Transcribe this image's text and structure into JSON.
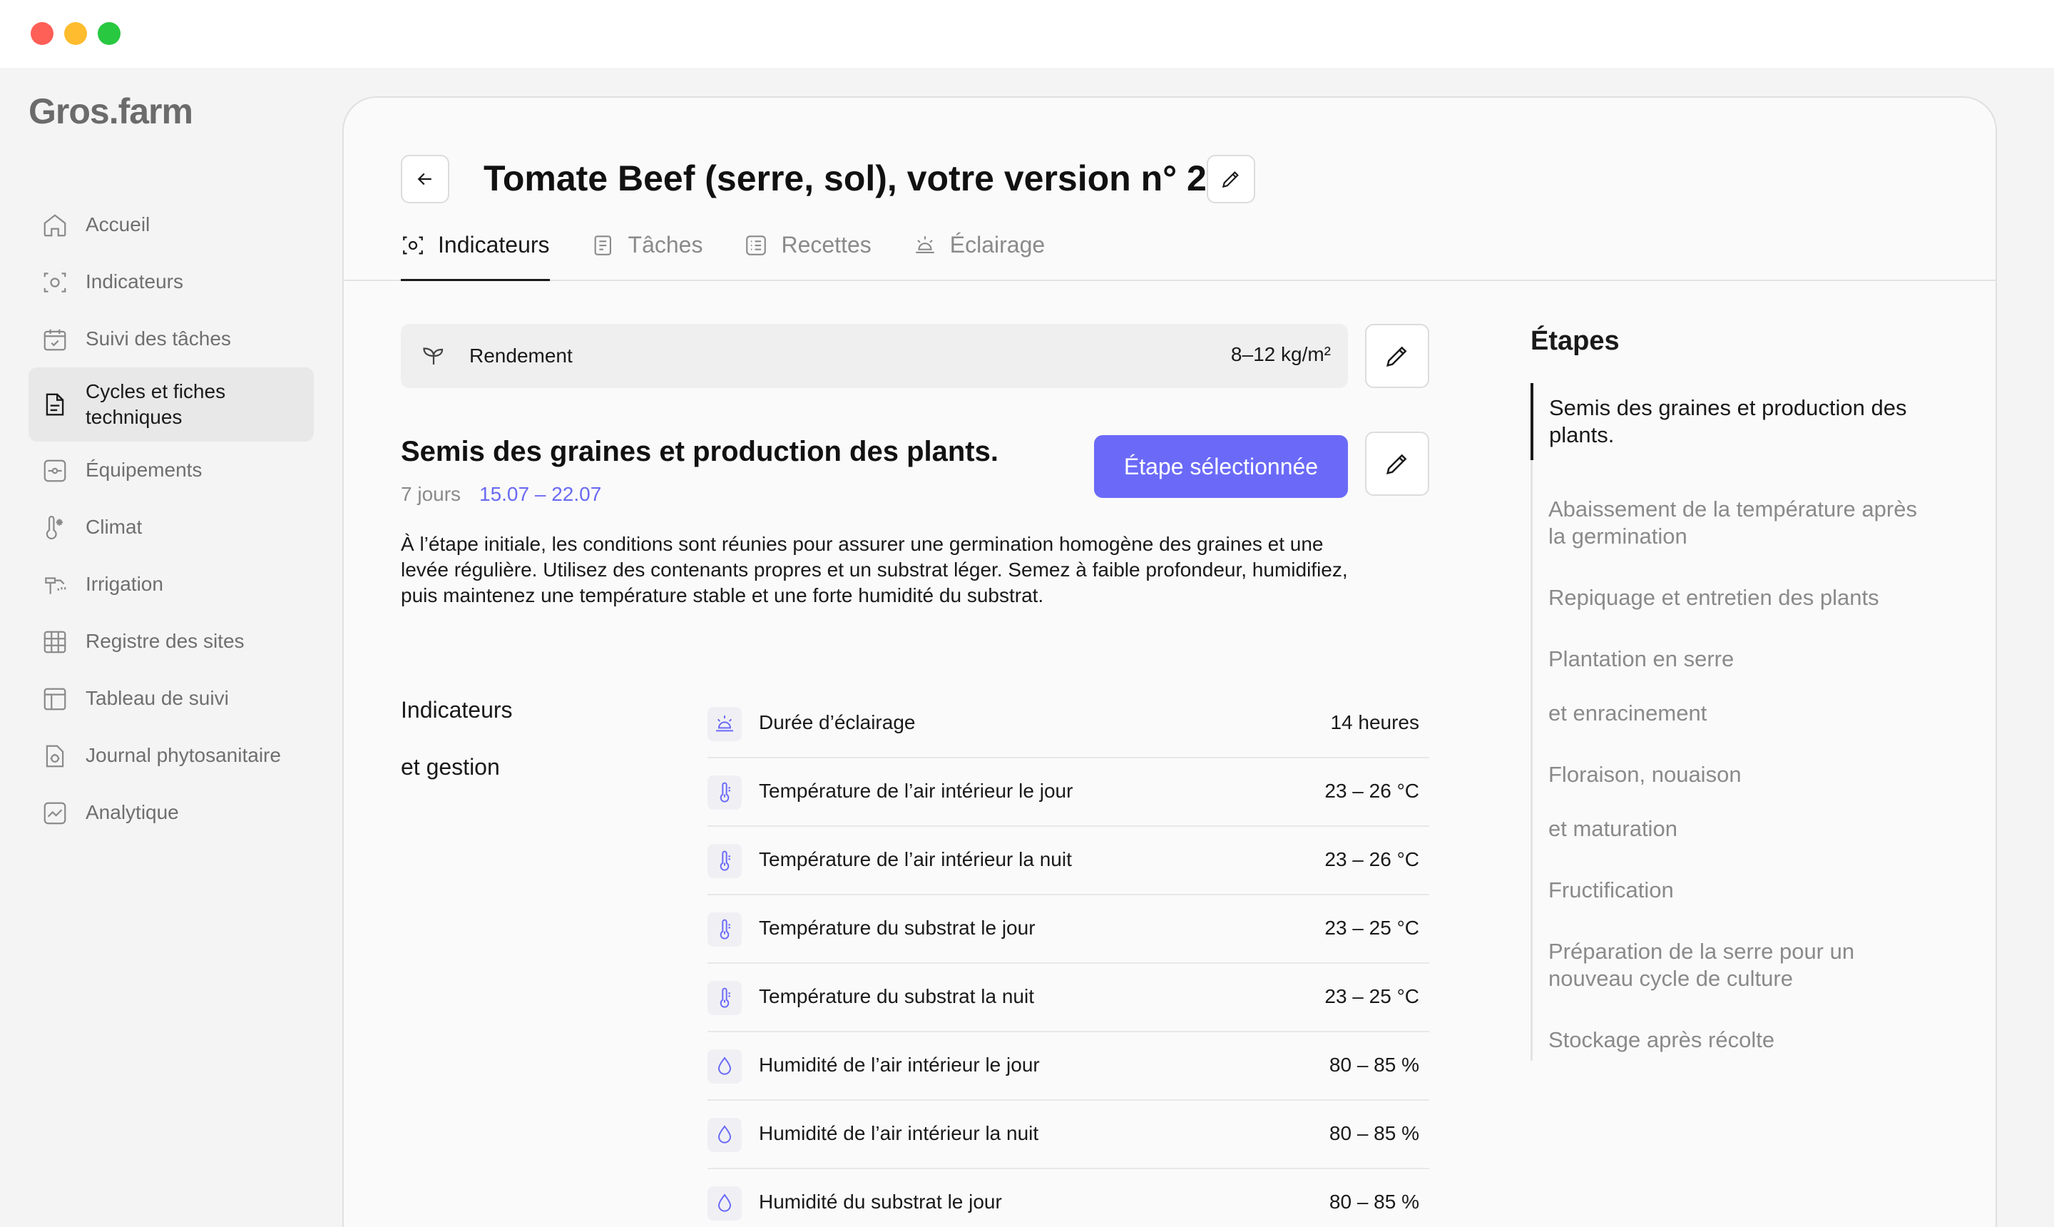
{
  "app": {
    "logo": "Gros.farm"
  },
  "sidebar": {
    "items": [
      {
        "label": "Accueil",
        "icon": "home-icon"
      },
      {
        "label": "Indicateurs",
        "icon": "indicators-icon"
      },
      {
        "label": "Suivi des tâches",
        "icon": "calendar-check-icon"
      },
      {
        "label": "Cycles et fiches techniques",
        "icon": "document-icon",
        "active": true
      },
      {
        "label": "Équipements",
        "icon": "equipment-icon"
      },
      {
        "label": "Climat",
        "icon": "climate-icon"
      },
      {
        "label": "Irrigation",
        "icon": "irrigation-icon"
      },
      {
        "label": "Registre des sites",
        "icon": "grid-icon"
      },
      {
        "label": "Tableau de suivi",
        "icon": "table-icon"
      },
      {
        "label": "Journal phytosanitaire",
        "icon": "journal-icon"
      },
      {
        "label": "Analytique",
        "icon": "analytics-icon"
      }
    ]
  },
  "header": {
    "title": "Tomate Beef (serre, sol), votre version n° 2",
    "tabs": [
      {
        "label": "Indicateurs",
        "icon": "indicators-icon",
        "active": true
      },
      {
        "label": "Tâches",
        "icon": "tasks-icon"
      },
      {
        "label": "Recettes",
        "icon": "recipes-icon"
      },
      {
        "label": "Éclairage",
        "icon": "light-icon"
      }
    ]
  },
  "yield": {
    "label": "Rendement",
    "value": "8–12 kg/m²",
    "icon": "sprout-icon"
  },
  "stage": {
    "title": "Semis des graines et production des plants.",
    "days": "7 jours",
    "dates": "15.07 – 22.07",
    "selected_label": "Étape sélectionnée",
    "description": "À l’étape initiale, les conditions sont réunies pour assurer une germination homogène des graines et une levée régulière. Utilisez des contenants propres et un substrat léger. Semez à faible profondeur, humidifiez, puis maintenez une température stable et une forte humidité du substrat."
  },
  "indicators": {
    "title_line1": "Indicateurs",
    "title_line2": "et gestion",
    "rows": [
      {
        "label": "Durée d’éclairage",
        "value": "14 heures",
        "icon": "light-icon"
      },
      {
        "label": "Température de l’air intérieur le jour",
        "value": "23 – 26 °C",
        "icon": "thermometer-icon"
      },
      {
        "label": "Température de l’air intérieur la nuit",
        "value": "23 – 26 °C",
        "icon": "thermometer-icon"
      },
      {
        "label": "Température du substrat le jour",
        "value": "23 – 25 °C",
        "icon": "thermometer-icon"
      },
      {
        "label": "Température du substrat la nuit",
        "value": "23 – 25 °C",
        "icon": "thermometer-icon"
      },
      {
        "label": "Humidité de l’air intérieur le jour",
        "value": "80 – 85 %",
        "icon": "droplet-icon"
      },
      {
        "label": "Humidité de l’air intérieur la nuit",
        "value": "80 – 85 %",
        "icon": "droplet-icon"
      },
      {
        "label": "Humidité du substrat le jour",
        "value": "80 – 85 %",
        "icon": "droplet-icon"
      }
    ]
  },
  "steps": {
    "title": "Étapes",
    "items": [
      {
        "label": "Semis des graines et production des plants.",
        "active": true
      },
      {
        "label": "Abaissement de la température après la germination"
      },
      {
        "label": "Repiquage et entretien des plants"
      },
      {
        "label": "Plantation en serre"
      },
      {
        "label": "et enracinement"
      },
      {
        "label": "Floraison, nouaison"
      },
      {
        "label": "et maturation"
      },
      {
        "label": "Fructification"
      },
      {
        "label": "Préparation de la serre pour un nouveau cycle de culture"
      },
      {
        "label": "Stockage après récolte"
      }
    ]
  },
  "colors": {
    "accent": "#6b6af8",
    "dates": "#6a6af2"
  }
}
